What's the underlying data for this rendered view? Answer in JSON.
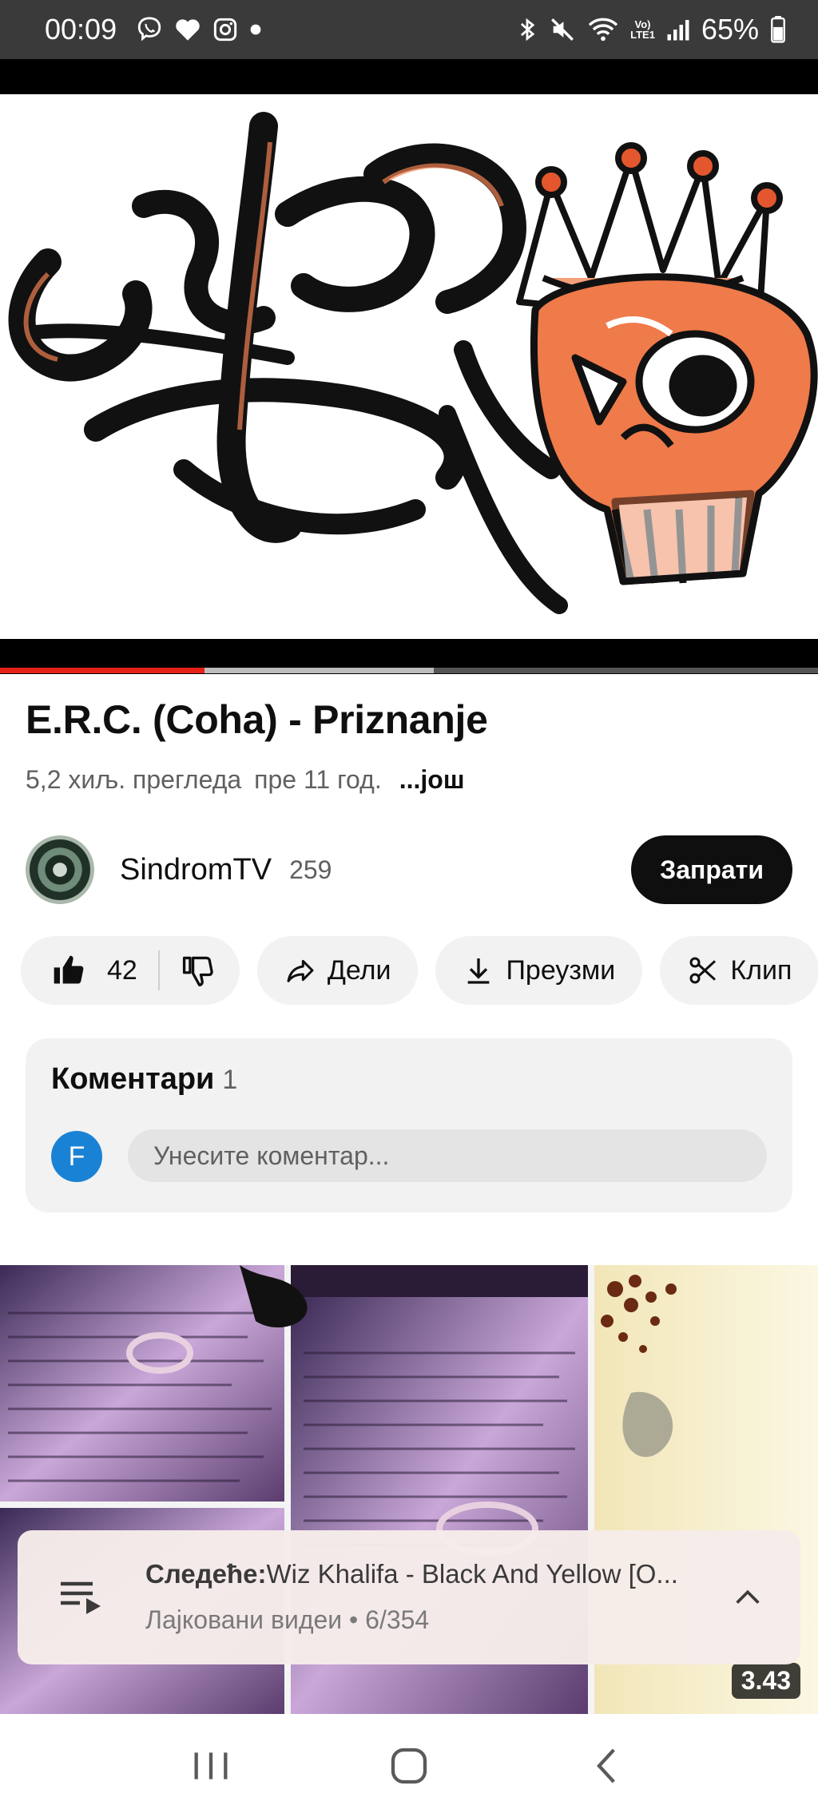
{
  "status_bar": {
    "time": "00:09",
    "battery": "65%",
    "network_label_top": "Vo)",
    "network_label_bottom": "LTE1",
    "icons": [
      "viber-icon",
      "heart-icon",
      "instagram-icon",
      "dot-icon",
      "bluetooth-icon",
      "mute-icon",
      "wifi-icon",
      "signal-icon",
      "battery-icon"
    ]
  },
  "player": {
    "progress_played_fraction": 0.25,
    "progress_buffered_fraction": 0.53
  },
  "video": {
    "title": "E.R.C. (Coha) - Priznanje",
    "views": "5,2 хиљ. прегледа",
    "age": "пре 11 год.",
    "more": "...још"
  },
  "channel": {
    "name": "SindromTV",
    "subscribers": "259",
    "subscribe_label": "Запрати"
  },
  "actions": {
    "like_count": "42",
    "share_label": "Дели",
    "download_label": "Преузми",
    "clip_label": "Клип"
  },
  "comments": {
    "heading": "Коментари",
    "count": "1",
    "user_initial": "F",
    "placeholder": "Унесите коментар..."
  },
  "next_video": {
    "duration": "3.43"
  },
  "playlist": {
    "next_prefix": "Следеће:",
    "next_title": "Wiz Khalifa - Black And Yellow [O...",
    "subtitle": "Лајковани видеи • 6/354"
  },
  "colors": {
    "progress_played": "#e62117",
    "subscribe_bg": "#0f0f0f",
    "comment_avatar": "#1a82d4"
  }
}
